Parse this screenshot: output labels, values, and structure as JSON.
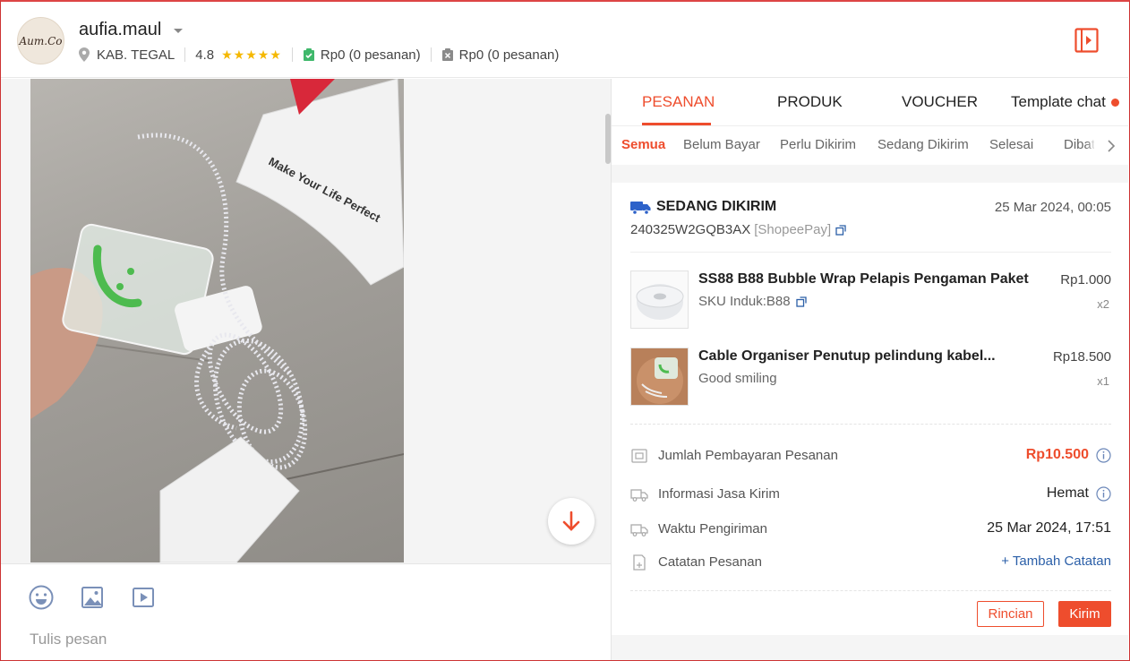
{
  "header": {
    "avatar_text": "Aum.Co",
    "username": "aufia.maul",
    "location": "KAB. TEGAL",
    "rating": "4.8",
    "stars": "★★★★★",
    "paid_summary": "Rp0 (0 pesanan)",
    "cancel_summary": "Rp0 (0 pesanan)"
  },
  "chat": {
    "photo_caption": "Make Your Life Perfect",
    "placeholder": "Tulis pesan"
  },
  "tabs": [
    "PESANAN",
    "PRODUK",
    "VOUCHER",
    "Template chat"
  ],
  "subtabs": [
    "Semua",
    "Belum Bayar",
    "Perlu Dikirim",
    "Sedang Dikirim",
    "Selesai",
    "Dibata"
  ],
  "order": {
    "status": "SEDANG DIKIRIM",
    "date": "25 Mar 2024, 00:05",
    "id": "240325W2GQB3AX",
    "payment": "[ShopeePay]",
    "items": [
      {
        "name": "SS88 B88 Bubble Wrap Pelapis Pengaman Paket",
        "sub": "SKU Induk:B88",
        "price": "Rp1.000",
        "qty": "x2"
      },
      {
        "name": "Cable Organiser Penutup pelindung kabel...",
        "sub": "Good smiling",
        "price": "Rp18.500",
        "qty": "x1"
      }
    ],
    "details": {
      "payment_label": "Jumlah Pembayaran Pesanan",
      "payment_value": "Rp10.500",
      "shipping_label": "Informasi Jasa Kirim",
      "shipping_value": "Hemat",
      "time_label": "Waktu Pengiriman",
      "time_value": "25 Mar 2024, 17:51",
      "note_label": "Catatan Pesanan",
      "note_action": "+ Tambah Catatan"
    },
    "buttons": {
      "detail": "Rincian",
      "send": "Kirim"
    }
  },
  "colors": {
    "accent": "#ee4d2d",
    "link": "#2b5fa8",
    "star": "#f5b800"
  }
}
